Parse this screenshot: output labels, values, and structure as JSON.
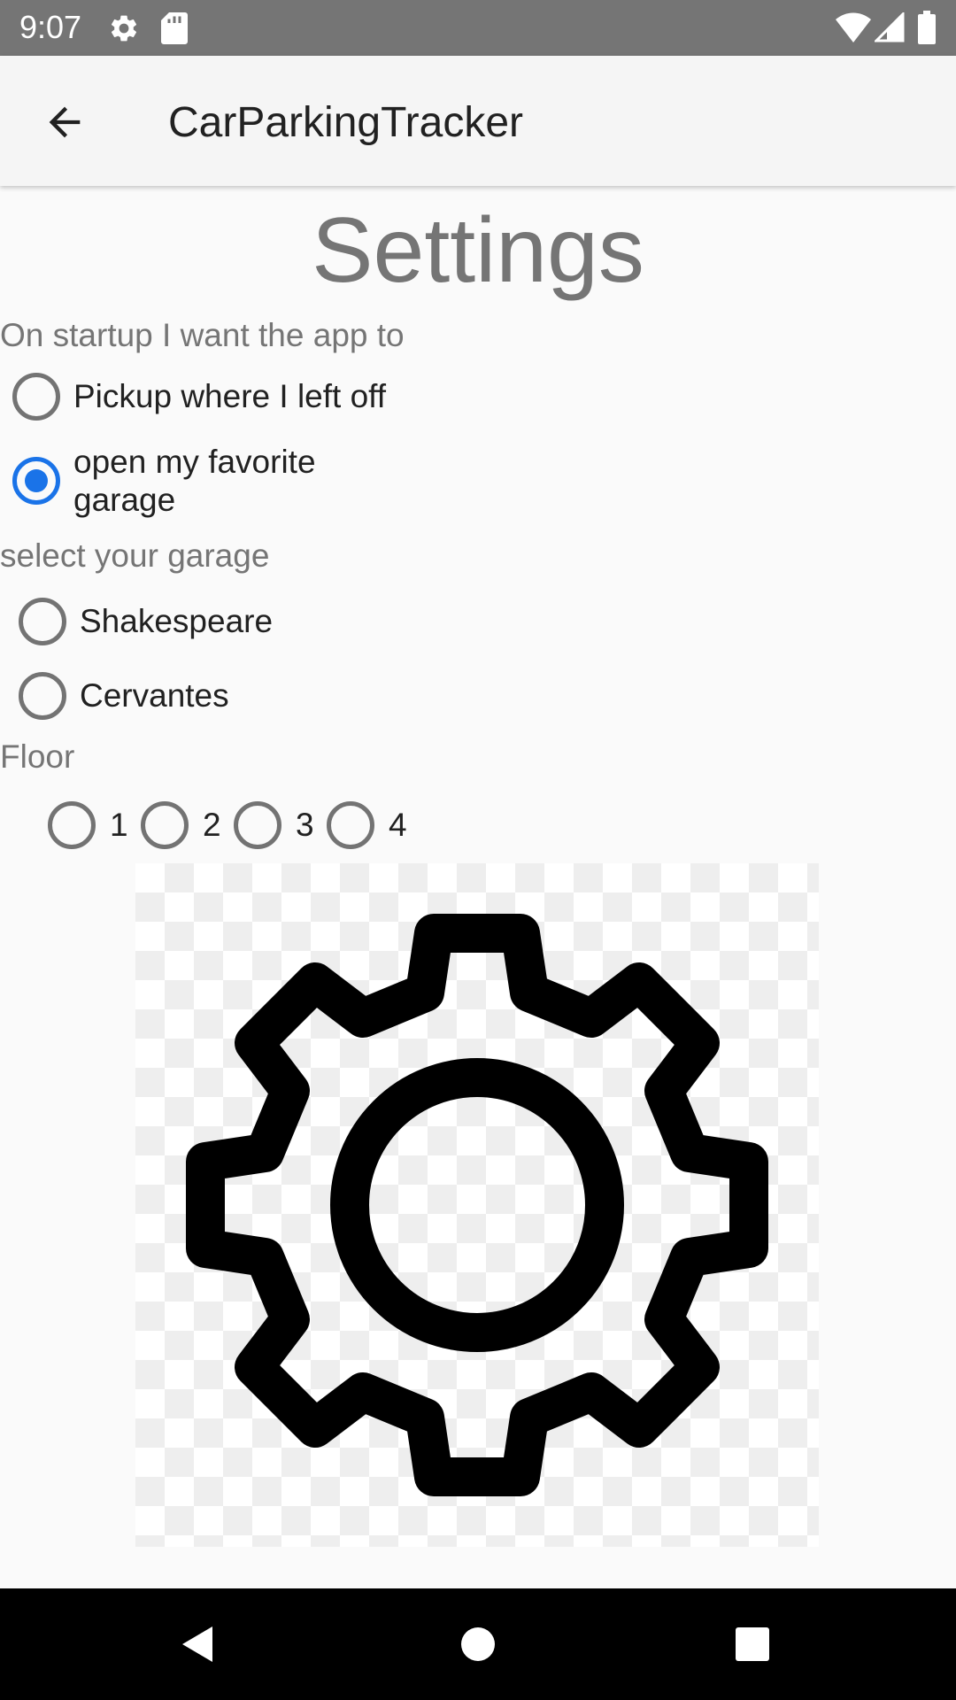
{
  "status_bar": {
    "time": "9:07",
    "left_icons": [
      "gear-icon",
      "sd-card-icon"
    ],
    "right_icons": [
      "wifi-icon",
      "cell-signal-icon",
      "battery-icon"
    ],
    "background": "#757575"
  },
  "app_bar": {
    "title": "CarParkingTracker",
    "back_icon": "arrow-back-icon"
  },
  "page": {
    "title": "Settings"
  },
  "startup": {
    "label": "On startup I want the app to",
    "options": [
      {
        "label": "Pickup where I left off",
        "checked": false
      },
      {
        "label": "open my favorite\ngarage",
        "checked": true
      }
    ]
  },
  "garage": {
    "label": "select your garage",
    "options": [
      {
        "label": "Shakespeare",
        "checked": false
      },
      {
        "label": "Cervantes",
        "checked": false
      }
    ]
  },
  "floor": {
    "label": "Floor",
    "options": [
      {
        "label": "1",
        "checked": false
      },
      {
        "label": "2",
        "checked": false
      },
      {
        "label": "3",
        "checked": false
      },
      {
        "label": "4",
        "checked": false
      }
    ]
  },
  "image": {
    "icon": "gear-icon"
  },
  "nav_bar": {
    "buttons": [
      "back-triangle-icon",
      "home-circle-icon",
      "recents-square-icon"
    ]
  },
  "colors": {
    "accent": "#1a73e8",
    "radio_unchecked": "#737373",
    "secondary_text": "#757575"
  }
}
